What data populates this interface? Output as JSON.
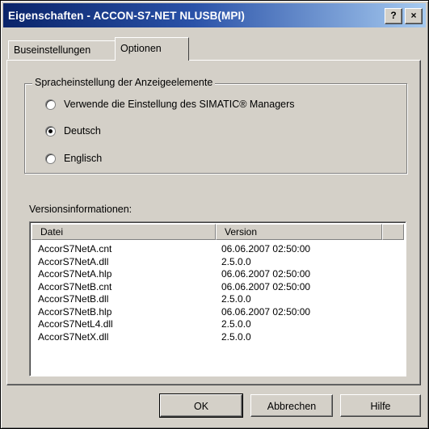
{
  "window": {
    "title": "Eigenschaften - ACCON-S7-NET NLUSB(MPI)"
  },
  "titlebar": {
    "help_label": "?",
    "close_label": "×"
  },
  "tabs": [
    {
      "label": "Buseinstellungen",
      "active": false
    },
    {
      "label": "Optionen",
      "active": true
    }
  ],
  "language_group": {
    "label": "Spracheinstellung der Anzeigeelemente",
    "options": [
      {
        "label": "Verwende die Einstellung des SIMATIC® Managers",
        "selected": false
      },
      {
        "label": "Deutsch",
        "selected": true
      },
      {
        "label": "Englisch",
        "selected": false
      }
    ]
  },
  "version_info": {
    "label": "Versionsinformationen:",
    "columns": [
      "Datei",
      "Version"
    ],
    "rows": [
      [
        "AccorS7NetA.cnt",
        "06.06.2007  02:50:00"
      ],
      [
        "AccorS7NetA.dll",
        "2.5.0.0"
      ],
      [
        "AccorS7NetA.hlp",
        "06.06.2007  02:50:00"
      ],
      [
        "AccorS7NetB.cnt",
        "06.06.2007  02:50:00"
      ],
      [
        "AccorS7NetB.dll",
        "2.5.0.0"
      ],
      [
        "AccorS7NetB.hlp",
        "06.06.2007  02:50:00"
      ],
      [
        "AccorS7NetL4.dll",
        "2.5.0.0"
      ],
      [
        "AccorS7NetX.dll",
        "2.5.0.0"
      ]
    ]
  },
  "buttons": {
    "ok": "OK",
    "cancel": "Abbrechen",
    "help": "Hilfe"
  }
}
